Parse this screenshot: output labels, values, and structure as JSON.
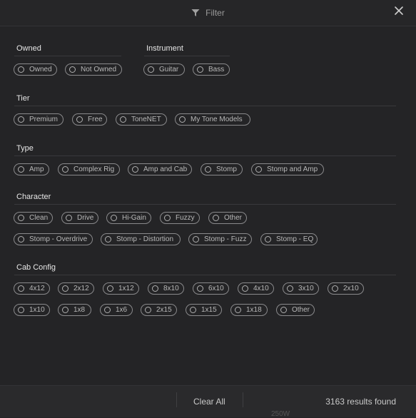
{
  "header": {
    "title": "Filter"
  },
  "sections": {
    "owned": {
      "title": "Owned",
      "options": [
        "Owned",
        "Not Owned"
      ]
    },
    "instrument": {
      "title": "Instrument",
      "options": [
        "Guitar",
        "Bass"
      ]
    },
    "tier": {
      "title": "Tier",
      "options": [
        "Premium",
        "Free",
        "ToneNET",
        "My Tone Models"
      ]
    },
    "type": {
      "title": "Type",
      "options": [
        "Amp",
        "Complex Rig",
        "Amp and Cab",
        "Stomp",
        "Stomp and Amp"
      ]
    },
    "character": {
      "title": "Character",
      "options": [
        "Clean",
        "Drive",
        "Hi-Gain",
        "Fuzzy",
        "Other",
        "Stomp - Overdrive",
        "Stomp - Distortion",
        "Stomp - Fuzz",
        "Stomp - EQ"
      ]
    },
    "cab": {
      "title": "Cab Config",
      "options": [
        "4x12",
        "2x12",
        "1x12",
        "8x10",
        "6x10",
        "4x10",
        "3x10",
        "2x10",
        "1x10",
        "1x8",
        "1x6",
        "2x15",
        "1x15",
        "1x18",
        "Other"
      ]
    }
  },
  "footer": {
    "clear_all": "Clear All",
    "results": "3163 results found"
  },
  "background_fragments": {
    "right": "250W"
  }
}
